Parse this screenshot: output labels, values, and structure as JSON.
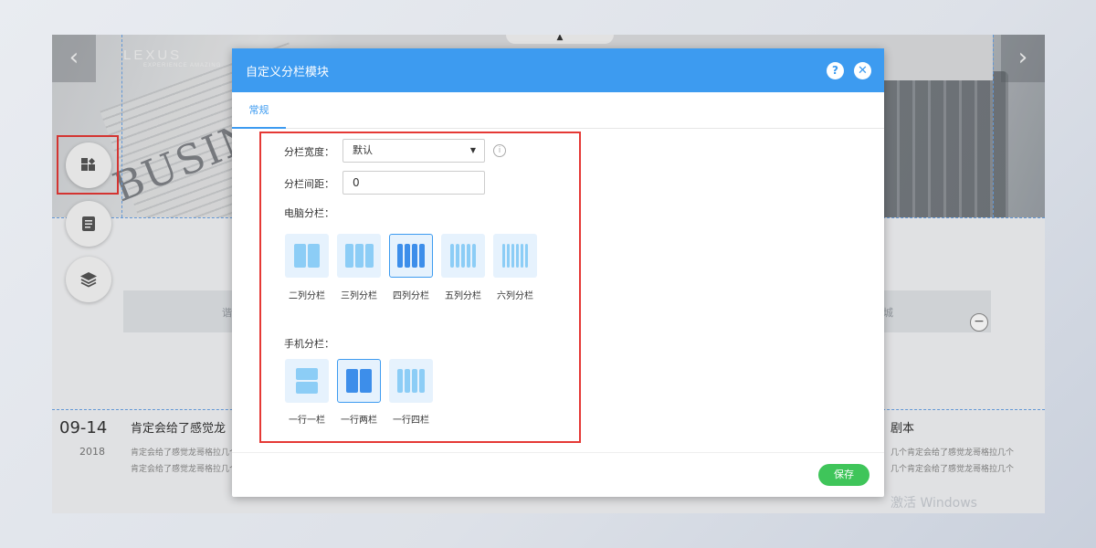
{
  "background": {
    "logo_main": "LEXUS",
    "logo_sub": "EXPERIENCE AMAZING",
    "banner_word": "BUSINESS",
    "nav_left_arrow": "‹",
    "nav_right_arrow": "›",
    "band_left_text": "谐",
    "band_right_text": "城",
    "news": {
      "date": "09-14",
      "year": "2018",
      "title": "肯定会给了感觉龙",
      "desc_lines": [
        "肯定会给了感觉龙哥格拉几个",
        "肯定会给了感觉龙哥格拉几个"
      ],
      "right_title": "剧本",
      "right_desc_lines": [
        "几个肯定会给了感觉龙哥格拉几个",
        "几个肯定会给了感觉龙哥格拉几个"
      ]
    },
    "watermark": "激活 Windows"
  },
  "dialog": {
    "title": "自定义分栏模块",
    "help_icon": "?",
    "close_icon": "✕",
    "tab": "常规",
    "width_label": "分栏宽度：",
    "width_value": "默认",
    "info_icon": "i",
    "gap_label": "分栏间距：",
    "gap_value": "0",
    "pc_label": "电脑分栏：",
    "pc_options": [
      {
        "label": "二列分栏",
        "cols": 2,
        "selected": false
      },
      {
        "label": "三列分栏",
        "cols": 3,
        "selected": false
      },
      {
        "label": "四列分栏",
        "cols": 4,
        "selected": true
      },
      {
        "label": "五列分栏",
        "cols": 5,
        "selected": false
      },
      {
        "label": "六列分栏",
        "cols": 6,
        "selected": false
      }
    ],
    "mobile_label": "手机分栏：",
    "mobile_options": [
      {
        "label": "一行一栏",
        "cols": 1,
        "selected": false
      },
      {
        "label": "一行两栏",
        "cols": 2,
        "selected": true
      },
      {
        "label": "一行四栏",
        "cols": 4,
        "selected": false
      }
    ],
    "save_label": "保存"
  },
  "colors": {
    "header_blue": "#3d9bf0",
    "save_green": "#3fc55a",
    "highlight_red": "#e53935"
  }
}
